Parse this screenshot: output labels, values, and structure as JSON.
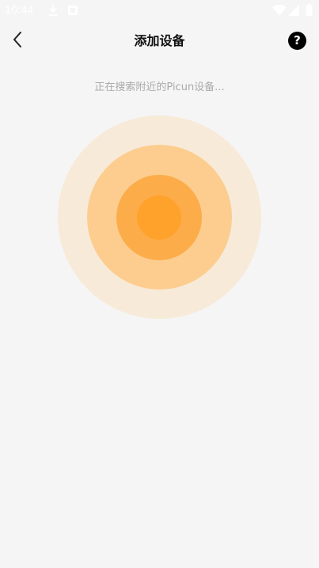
{
  "status_bar": {
    "time": "10:44",
    "icons": [
      "download-icon",
      "notification-square-icon",
      "wifi-icon",
      "signal-icon",
      "battery-icon"
    ]
  },
  "header": {
    "title": "添加设备",
    "back_icon": "chevron-left-icon",
    "help_label": "?"
  },
  "main": {
    "search_status": "正在搜索附近的Picun设备..."
  },
  "colors": {
    "background": "#f5f5f5",
    "ring_outer": "#f7ead9",
    "ring_second": "#fccd8f",
    "ring_third": "#fdac4a",
    "ring_core": "#ffa22c"
  }
}
